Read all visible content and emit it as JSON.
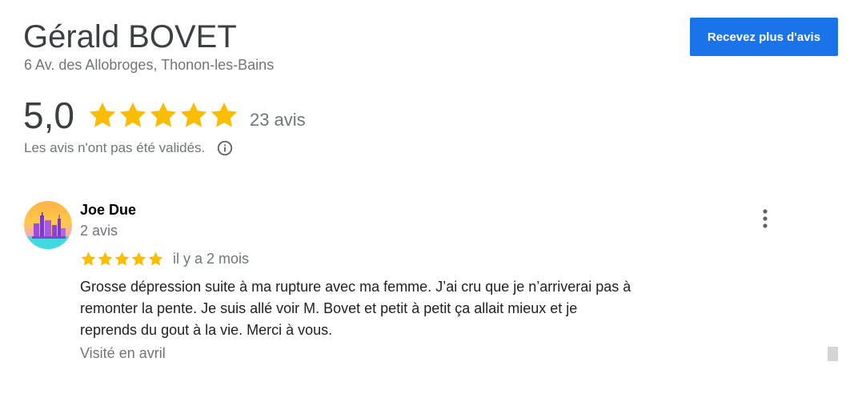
{
  "business": {
    "name": "Gérald BOVET",
    "address": "6 Av. des Allobroges, Thonon-les-Bains"
  },
  "cta": {
    "label": "Recevez plus d'avis"
  },
  "rating": {
    "value": "5,0",
    "stars": 5,
    "count_label": "23 avis",
    "not_validated": "Les avis n'ont pas été validés."
  },
  "review": {
    "author": "Joe Due",
    "author_reviews": "2 avis",
    "stars": 5,
    "date": "il y a 2 mois",
    "lines": [
      "Grosse dépression suite à ma rupture avec ma femme. J’ai cru que je n’arriverai pas à",
      "remonter la pente. Je suis allé voir M. Bovet et petit à petit ça allait mieux et je",
      "reprends du gout à la vie. Merci à vous."
    ],
    "visited": "Visité en avril"
  },
  "icons": {
    "star": "star-icon",
    "info": "info-icon",
    "more": "more-vert-icon"
  },
  "colors": {
    "accent": "#1a73e8",
    "star": "#fbbc04",
    "secondary_text": "#70757a"
  }
}
